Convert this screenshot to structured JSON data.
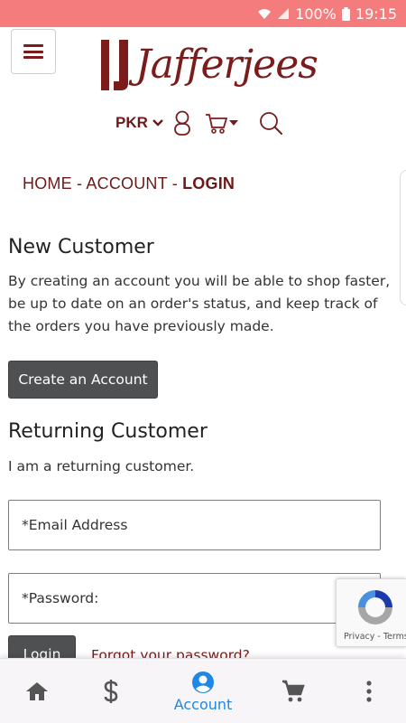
{
  "status_bar": {
    "battery": "100%",
    "time": "19:15"
  },
  "header": {
    "logo_text": "Jafferjees",
    "currency": "PKR"
  },
  "breadcrumb": {
    "home": "HOME",
    "account": "ACCOUNT",
    "current": "LOGIN",
    "separator": "-"
  },
  "new_customer": {
    "title": "New Customer",
    "description": "By creating an account you will be able to shop faster, be up to date on an order's status, and keep track of the orders you have previously made.",
    "create_button": "Create an Account"
  },
  "returning_customer": {
    "title": "Returning Customer",
    "description": "I am a returning customer.",
    "email_placeholder": "*Email Address",
    "password_placeholder": "*Password:",
    "login_button": "Login",
    "forgot_link": "Forgot your password?"
  },
  "recaptcha": {
    "text": "Privacy - Terms"
  },
  "bottom_nav": {
    "items": [
      {
        "icon": "home-icon",
        "label": ""
      },
      {
        "icon": "dollar-icon",
        "label": ""
      },
      {
        "icon": "account-icon",
        "label": "Account",
        "active": true
      },
      {
        "icon": "cart-icon",
        "label": ""
      },
      {
        "icon": "more-vertical-icon",
        "label": ""
      }
    ]
  },
  "colors": {
    "status_bar": "#f47c7c",
    "brand": "#7a1c1c",
    "button": "#4f5052",
    "nav_active": "#1e88e5"
  }
}
